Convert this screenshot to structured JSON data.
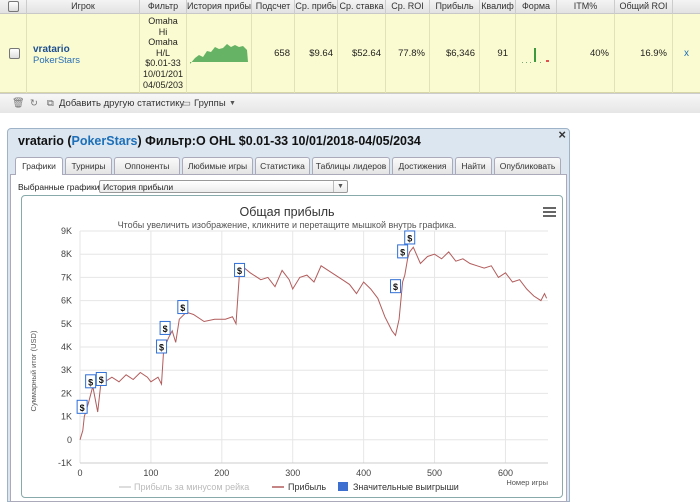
{
  "grid": {
    "headers": [
      "Игрок",
      "Фильтр",
      "История прибы",
      "Подсчет",
      "Ср. прибь",
      "Ср. ставка",
      "Ср. ROI",
      "Прибыль",
      "Квалиф",
      "Форма",
      "ITM%",
      "Общий ROI"
    ],
    "row": {
      "player": "vratario",
      "site": "PokerStars",
      "filter_lines": [
        "Omaha",
        "Hi",
        "Omaha",
        "H/L",
        "$0.01-33",
        "10/01/201",
        "04/05/203"
      ],
      "count": "658",
      "avg_profit": "$9.64",
      "avg_stake": "$52.64",
      "avg_roi": "77.8%",
      "profit": "$6,346",
      "qualif": "91",
      "itm": "40%",
      "total_roi": "16.9%",
      "remove": "x"
    },
    "toolbar": {
      "add_label": "Добавить другую статистику",
      "groups_label": "Группы"
    }
  },
  "window": {
    "player": "vratario",
    "site": "PokerStars",
    "filter_text": "Фильтр:O OHL $0.01-33 10/01/2018-04/05/2034",
    "close": "×",
    "tabs": [
      "Графики",
      "Турниры",
      "Оппоненты",
      "Любимые игры",
      "Статистика",
      "Таблицы лидеров",
      "Достижения",
      "Найти",
      "Опубликовать"
    ],
    "active_tab": 0,
    "chart_select_label": "Выбранные графики:",
    "chart_select_value": "История прибыли"
  },
  "chart_data": {
    "type": "line",
    "title": "Общая прибыль",
    "subtitle": "Чтобы увеличить изображение, кликните и перетащите мышкой внутрь графика.",
    "xlabel": "Номер игры",
    "ylabel": "Суммарный итог (USD)",
    "xlim": [
      0,
      660
    ],
    "ylim": [
      -1000,
      9000
    ],
    "x_ticks": [
      0,
      100,
      200,
      300,
      400,
      500,
      600
    ],
    "y_ticks": [
      -1000,
      0,
      1000,
      2000,
      3000,
      4000,
      5000,
      6000,
      7000,
      8000,
      9000
    ],
    "y_tick_labels": [
      "-1K",
      "0",
      "1K",
      "2K",
      "3K",
      "4K",
      "5K",
      "6K",
      "7K",
      "8K",
      "9K"
    ],
    "grid": true,
    "legend_position": "bottom",
    "legend": [
      "Прибыль за минусом рейка",
      "Прибыль",
      "Значительные выигрыши"
    ],
    "series": [
      {
        "name": "Прибыль",
        "color": "#b25c5c",
        "x": [
          0,
          4,
          6,
          12,
          18,
          25,
          30,
          35,
          45,
          55,
          65,
          75,
          85,
          95,
          100,
          110,
          115,
          118,
          125,
          130,
          135,
          140,
          150,
          160,
          175,
          190,
          205,
          215,
          220,
          225,
          228,
          232,
          240,
          255,
          265,
          275,
          285,
          295,
          300,
          310,
          320,
          330,
          340,
          350,
          360,
          370,
          380,
          390,
          400,
          410,
          420,
          430,
          440,
          445,
          450,
          455,
          458,
          462,
          465,
          470,
          480,
          490,
          500,
          510,
          520,
          530,
          540,
          550,
          560,
          570,
          580,
          590,
          600,
          610,
          620,
          630,
          640,
          650,
          655,
          658
        ],
        "y": [
          0,
          400,
          1000,
          1600,
          2300,
          1200,
          2600,
          2500,
          2700,
          2500,
          2800,
          2600,
          2900,
          2700,
          2500,
          2700,
          2400,
          3900,
          4400,
          4700,
          4200,
          5200,
          5500,
          5400,
          5100,
          5200,
          5200,
          5300,
          5000,
          7200,
          7400,
          7400,
          7200,
          6900,
          7000,
          6600,
          7300,
          6900,
          6500,
          7000,
          7100,
          6800,
          7500,
          7300,
          7100,
          6900,
          6700,
          6300,
          6800,
          6500,
          6100,
          5300,
          4700,
          4500,
          5200,
          6800,
          7100,
          7800,
          8100,
          8300,
          7600,
          7900,
          8000,
          7800,
          8100,
          7700,
          7800,
          7600,
          7500,
          7400,
          7500,
          7000,
          7200,
          6800,
          6900,
          6500,
          6200,
          6000,
          6300,
          6100
        ]
      }
    ],
    "big_wins_x": [
      3,
      15,
      30,
      115,
      120,
      145,
      225,
      445,
      455,
      465
    ],
    "big_wins_y": [
      1400,
      2500,
      2600,
      4000,
      4800,
      5700,
      7300,
      6600,
      8100,
      8700
    ],
    "big_win_symbol": "$"
  }
}
